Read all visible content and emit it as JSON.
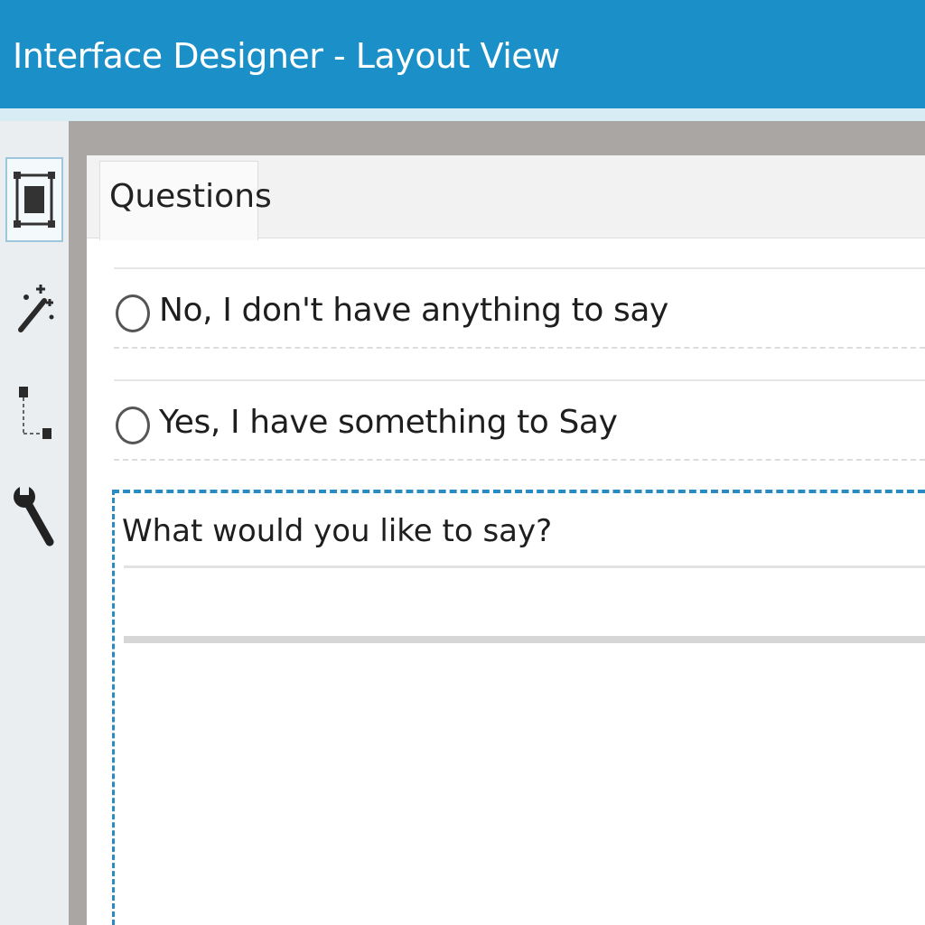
{
  "window": {
    "title": "Interface Designer - Layout View"
  },
  "toolbar": {
    "tools": [
      {
        "icon": "layout-icon",
        "active": true
      },
      {
        "icon": "magic-wand-icon",
        "active": false
      },
      {
        "icon": "connector-icon",
        "active": false
      },
      {
        "icon": "wrench-icon",
        "active": false
      }
    ]
  },
  "tabs": [
    {
      "label": "Questions",
      "selected": true
    }
  ],
  "form": {
    "options": [
      {
        "label": "No, I don't have anything to say",
        "checked": false
      },
      {
        "label": "Yes, I have something to Say",
        "checked": false
      }
    ],
    "text_field": {
      "label": "What would you like to say?",
      "value": ""
    }
  },
  "colors": {
    "titlebar": "#1a8fc8",
    "selection_outline": "#2a8ac2",
    "canvas_frame": "#a9a6a3"
  }
}
